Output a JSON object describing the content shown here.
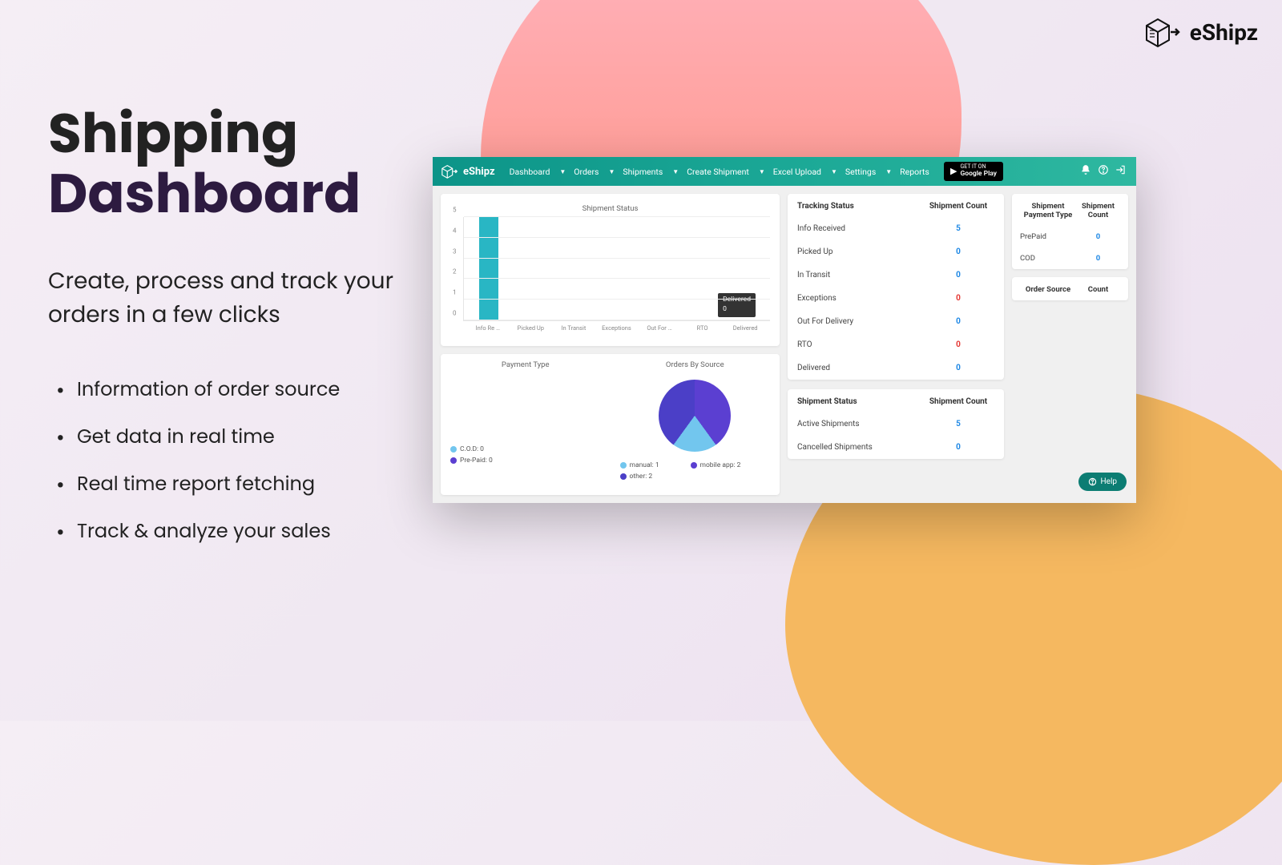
{
  "brand": "eShipz",
  "marketing": {
    "title_line1": "Shipping",
    "title_line2": "Dashboard",
    "subtitle": "Create, process and track your orders in a few clicks",
    "bullets": [
      "Information of order source",
      "Get data in real time",
      "Real time report fetching",
      "Track & analyze your sales"
    ]
  },
  "topbar": {
    "items": [
      {
        "label": "Dashboard",
        "dropdown": true
      },
      {
        "label": "Orders",
        "dropdown": true
      },
      {
        "label": "Shipments",
        "dropdown": true
      },
      {
        "label": "Create Shipment",
        "dropdown": true
      },
      {
        "label": "Excel Upload",
        "dropdown": true
      },
      {
        "label": "Settings",
        "dropdown": true
      },
      {
        "label": "Reports",
        "dropdown": false
      }
    ],
    "google_play_top": "GET IT ON",
    "google_play_bottom": "Google Play"
  },
  "chart_data": [
    {
      "type": "bar",
      "title": "Shipment Status",
      "categories": [
        "Info Re …",
        "Picked Up",
        "In Transit",
        "Exceptions",
        "Out For …",
        "RTO",
        "Delivered"
      ],
      "values": [
        5,
        0,
        0,
        0,
        0,
        0,
        0
      ],
      "ylim": [
        0,
        5
      ],
      "yticks": [
        0,
        1,
        2,
        3,
        4,
        5
      ],
      "tooltip": {
        "category": "Delivered",
        "value": 0
      },
      "bar_color": "#29b6c4"
    },
    {
      "type": "pie",
      "title": "Payment Type",
      "series": [
        {
          "name": "C.O.D",
          "value": 0,
          "color": "#72c6ee"
        },
        {
          "name": "Pre-Paid",
          "value": 0,
          "color": "#5b3fd1"
        }
      ]
    },
    {
      "type": "pie",
      "title": "Orders By Source",
      "series": [
        {
          "name": "manual",
          "value": 1,
          "color": "#72c6ee"
        },
        {
          "name": "mobile app",
          "value": 2,
          "color": "#5b3fd1"
        },
        {
          "name": "other",
          "value": 2,
          "color": "#4b3fc7"
        }
      ]
    }
  ],
  "tables": {
    "tracking": {
      "headers": [
        "Tracking Status",
        "Shipment Count"
      ],
      "rows": [
        {
          "label": "Info Received",
          "value": 5,
          "cls": "val-blue"
        },
        {
          "label": "Picked Up",
          "value": 0,
          "cls": "val-blue"
        },
        {
          "label": "In Transit",
          "value": 0,
          "cls": "val-blue"
        },
        {
          "label": "Exceptions",
          "value": 0,
          "cls": "val-red"
        },
        {
          "label": "Out For Delivery",
          "value": 0,
          "cls": "val-blue"
        },
        {
          "label": "RTO",
          "value": 0,
          "cls": "val-red"
        },
        {
          "label": "Delivered",
          "value": 0,
          "cls": "val-blue"
        }
      ]
    },
    "shipment_status": {
      "headers": [
        "Shipment Status",
        "Shipment Count"
      ],
      "rows": [
        {
          "label": "Active Shipments",
          "value": 5,
          "cls": "val-blue"
        },
        {
          "label": "Cancelled Shipments",
          "value": 0,
          "cls": "val-blue"
        }
      ]
    },
    "payment_type": {
      "headers": [
        "Shipment Payment Type",
        "Shipment Count"
      ],
      "rows": [
        {
          "label": "PrePaid",
          "value": 0,
          "cls": "val-blue"
        },
        {
          "label": "COD",
          "value": 0,
          "cls": "val-blue"
        }
      ]
    },
    "order_source": {
      "headers": [
        "Order Source",
        "Count"
      ],
      "rows": []
    }
  },
  "help_label": "Help"
}
